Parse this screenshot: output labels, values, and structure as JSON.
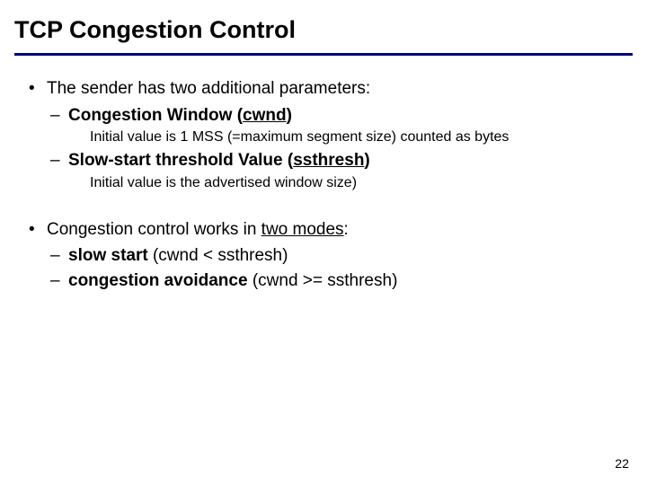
{
  "title": "TCP Congestion Control",
  "bullets": {
    "b1": {
      "text": "The sender has two additional parameters:",
      "items": {
        "i1": {
          "label_pre": "Congestion Window (",
          "label_u": "cwnd",
          "label_post": ")",
          "sub": "Initial value is 1 MSS (=maximum segment size) counted as bytes"
        },
        "i2": {
          "label_pre": "Slow-start threshold Value (",
          "label_u": "ssthresh",
          "label_post": ")",
          "sub": "Initial value is the advertised window size)"
        }
      }
    },
    "b2": {
      "text_pre": "Congestion control works in ",
      "text_u": "two modes",
      "text_post": ":",
      "items": {
        "i1": {
          "label": "slow start",
          "cond": " (cwnd < ssthresh)"
        },
        "i2": {
          "label": "congestion avoidance",
          "cond": " (cwnd >= ssthresh)"
        }
      }
    }
  },
  "page_number": "22"
}
